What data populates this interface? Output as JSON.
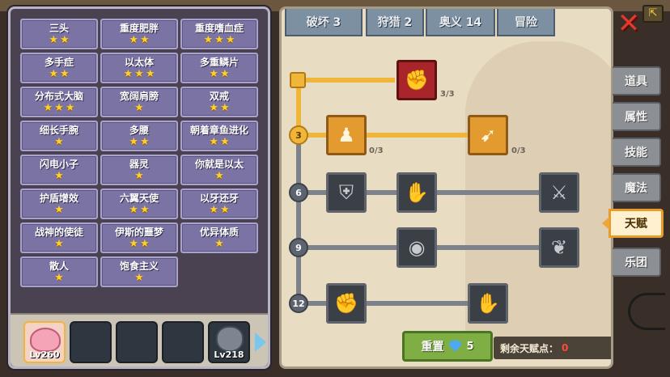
{
  "cards": [
    {
      "name": "三头",
      "stars": 2
    },
    {
      "name": "重度肥胖",
      "stars": 2
    },
    {
      "name": "重度嗜血症",
      "stars": 3
    },
    {
      "name": "多手症",
      "stars": 2
    },
    {
      "name": "以太体",
      "stars": 3
    },
    {
      "name": "多重鳞片",
      "stars": 2
    },
    {
      "name": "分布式大脑",
      "stars": 3
    },
    {
      "name": "宽阔肩膀",
      "stars": 1
    },
    {
      "name": "双戒",
      "stars": 2
    },
    {
      "name": "细长手腕",
      "stars": 1
    },
    {
      "name": "多腰",
      "stars": 2
    },
    {
      "name": "朝着章鱼进化",
      "stars": 2
    },
    {
      "name": "闪电小子",
      "stars": 1
    },
    {
      "name": "器灵",
      "stars": 1
    },
    {
      "name": "你就是以太",
      "stars": 1
    },
    {
      "name": "护盾增效",
      "stars": 1
    },
    {
      "name": "六翼天使",
      "stars": 2
    },
    {
      "name": "以牙还牙",
      "stars": 2
    },
    {
      "name": "战神的使徒",
      "stars": 1
    },
    {
      "name": "伊斯的噩梦",
      "stars": 2
    },
    {
      "name": "优异体质",
      "stars": 1
    },
    {
      "name": "散人",
      "stars": 1
    },
    {
      "name": "饱食主义",
      "stars": 1
    }
  ],
  "heroes": [
    {
      "level": "Lv260",
      "type": "pink",
      "active": true
    },
    {
      "level": "",
      "type": "empty"
    },
    {
      "level": "",
      "type": "empty"
    },
    {
      "level": "",
      "type": "empty"
    },
    {
      "level": "Lv218",
      "type": "grey"
    }
  ],
  "tabs": [
    {
      "label": "破坏 3",
      "active": true
    },
    {
      "label": "狩猎 2",
      "active": false
    },
    {
      "label": "奥义 14",
      "active": false
    },
    {
      "label": "冒险",
      "active": false
    }
  ],
  "tree": {
    "rows": [
      "",
      "3",
      "6",
      "9",
      "12"
    ],
    "counts": {
      "arm_wrestle": "3/3",
      "body": "0/3",
      "arrow": "0/3"
    }
  },
  "reset": {
    "label": "重置",
    "cost": "5"
  },
  "points": {
    "label": "剩余天赋点：",
    "value": "0"
  },
  "side_menu": [
    {
      "label": "道具",
      "active": false
    },
    {
      "label": "属性",
      "active": false
    },
    {
      "label": "技能",
      "active": false
    },
    {
      "label": "魔法",
      "active": false
    },
    {
      "label": "天赋",
      "active": true
    },
    {
      "label": "乐团",
      "active": false
    }
  ],
  "colors": {
    "accent": "#f0a636",
    "card": "#7a73a4",
    "points_value": "#ff4a3a"
  },
  "icons": {
    "close": "close-icon",
    "gem": "diamond-icon"
  }
}
